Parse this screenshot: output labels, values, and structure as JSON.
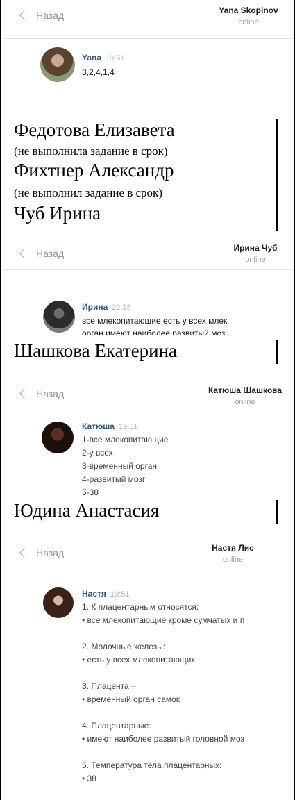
{
  "common": {
    "back_label": "Назад",
    "status": "online"
  },
  "screens": [
    {
      "contact": "Yana Skopinov",
      "author": "Yana",
      "time": "19:51",
      "lines": [
        "3,2,4,1,4"
      ]
    },
    {
      "contact": "Ирина Чуб",
      "author": "Ирина",
      "time": "22:18",
      "lines": [
        "все млекопитающие,есть у всех млек",
        "орган,имеют наиболее развитый моз"
      ]
    },
    {
      "contact": "Катюша Шашкова",
      "author": "Катюша",
      "time": "19:51",
      "lines": [
        "1-все млекопитающие",
        "2-у всех",
        "3-временный орган",
        "4-развитый мозг",
        "5-38"
      ]
    },
    {
      "contact": "Настя Лис",
      "author": "Настя",
      "time": "19:51",
      "lines": [
        "1. К плацентарным относятся:",
        "• все млекопитающие кроме сумчатых и п",
        "",
        "2. Молочные железы:",
        "• есть у всех млекопитающих",
        "",
        "3. Плацента –",
        "• временный орган самок",
        "",
        "4. Плацентарные:",
        "• имеют наиболее развитый головной моз",
        "",
        "5. Температура тела плацентарных:",
        "• 38"
      ]
    }
  ],
  "students": [
    {
      "name": "Федотова Елизавета",
      "note": "(не выполнила задание в срок)"
    },
    {
      "name": "Фихтнер Александр",
      "note": "(не выполнил задание в срок)"
    },
    {
      "name": "Чуб Ирина"
    },
    {
      "name": "Шашкова Екатерина"
    },
    {
      "name": "Юдина Анастасия"
    }
  ]
}
